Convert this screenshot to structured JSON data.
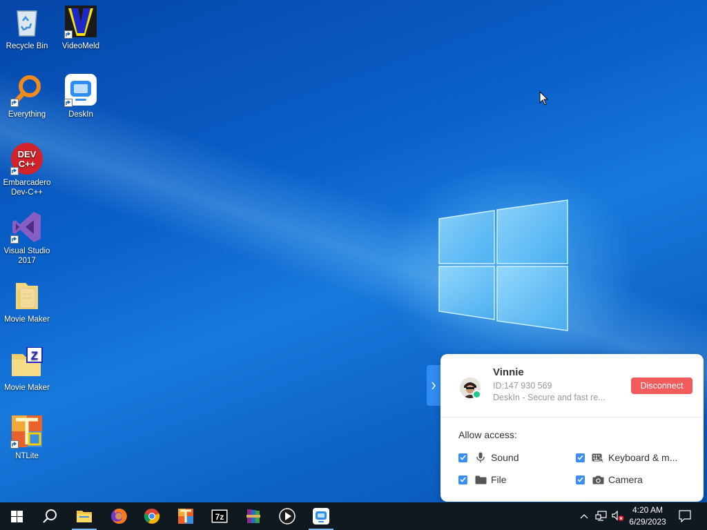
{
  "desktop": {
    "icons": [
      {
        "label": "Recycle Bin"
      },
      {
        "label": "VideoMeld"
      },
      {
        "label": "Everything"
      },
      {
        "label": "DeskIn"
      },
      {
        "label": "Embarcadero Dev-C++",
        "badge": "DEV C++"
      },
      {
        "label": "Visual Studio 2017"
      },
      {
        "label": "Movie Maker"
      },
      {
        "label": "Movie Maker",
        "badge": "Z"
      },
      {
        "label": "NTLite"
      }
    ]
  },
  "deskin_panel": {
    "user_name": "Vinnie",
    "user_id": "ID:147 930 569",
    "description": "DeskIn - Secure and fast re...",
    "disconnect_label": "Disconnect",
    "allow_title": "Allow access:",
    "permissions": [
      {
        "label": "Sound",
        "checked": true,
        "icon": "microphone-icon"
      },
      {
        "label": "Keyboard & m...",
        "checked": true,
        "icon": "keyboard-icon"
      },
      {
        "label": "File",
        "checked": true,
        "icon": "folder-icon"
      },
      {
        "label": "Camera",
        "checked": true,
        "icon": "camera-icon"
      }
    ],
    "accent": "#3a8ef2",
    "danger": "#f25c5c"
  },
  "taskbar": {
    "apps": [
      "start",
      "search",
      "file-explorer",
      "firefox",
      "chrome",
      "ntlite",
      "7zip",
      "winrar",
      "video-player",
      "deskin"
    ],
    "clock_time": "4:20 AM",
    "clock_date": "6/29/2023",
    "bg": "#101820"
  }
}
